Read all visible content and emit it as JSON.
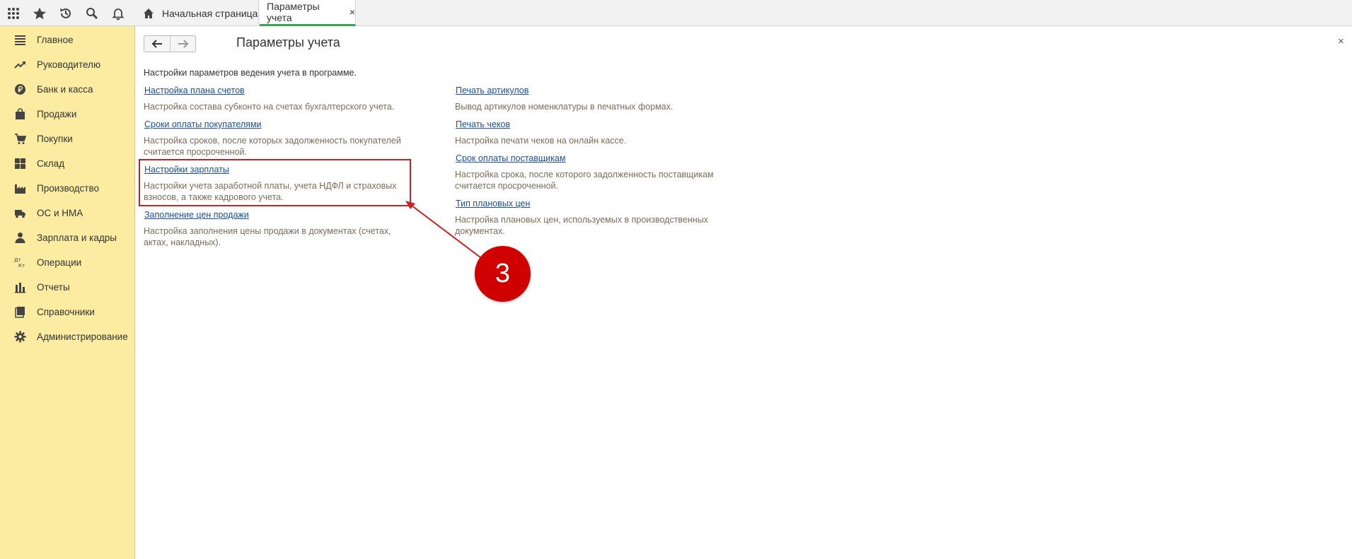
{
  "tabs": {
    "home": "Начальная страница",
    "params": "Параметры учета",
    "close": "×"
  },
  "sidebar": {
    "items": [
      {
        "label": "Главное",
        "icon": "menu-lines-icon"
      },
      {
        "label": "Руководителю",
        "icon": "trend-icon"
      },
      {
        "label": "Банк и касса",
        "icon": "ruble-coin-icon"
      },
      {
        "label": "Продажи",
        "icon": "shopping-bag-icon"
      },
      {
        "label": "Покупки",
        "icon": "cart-icon"
      },
      {
        "label": "Склад",
        "icon": "warehouse-grid-icon"
      },
      {
        "label": "Производство",
        "icon": "factory-icon"
      },
      {
        "label": "ОС и НМА",
        "icon": "truck-icon"
      },
      {
        "label": "Зарплата и кадры",
        "icon": "person-icon"
      },
      {
        "label": "Операции",
        "icon": "dt-kt-icon"
      },
      {
        "label": "Отчеты",
        "icon": "bar-chart-icon"
      },
      {
        "label": "Справочники",
        "icon": "books-icon"
      },
      {
        "label": "Администрирование",
        "icon": "gear-icon"
      }
    ]
  },
  "page": {
    "title": "Параметры учета",
    "close": "×",
    "intro": "Настройки параметров ведения учета в программе."
  },
  "settings": {
    "left": [
      {
        "link": "Настройка плана счетов",
        "desc": "Настройка состава субконто на счетах бухгалтерского учета."
      },
      {
        "link": "Сроки оплаты покупателями",
        "desc": "Настройка сроков, после которых задолженность покупателей считается просроченной."
      },
      {
        "link": "Настройки зарплаты",
        "desc": "Настройки учета заработной платы, учета НДФЛ и страховых взносов, а также кадрового учета."
      },
      {
        "link": "Заполнение цен продажи",
        "desc": "Настройка заполнения цены продажи в документах (счетах, актах, накладных)."
      }
    ],
    "right": [
      {
        "link": "Печать артикулов",
        "desc": "Вывод артикулов номенклатуры в печатных формах."
      },
      {
        "link": "Печать чеков",
        "desc": "Настройка печати чеков на онлайн кассе."
      },
      {
        "link": "Срок оплаты поставщикам",
        "desc": "Настройка срока, после которого задолженность поставщикам считается просроченной."
      },
      {
        "link": "Тип плановых цен",
        "desc": "Настройка плановых цен, используемых в производственных документах."
      }
    ]
  },
  "annotation": {
    "step": "3"
  },
  "colors": {
    "sidebar_bg": "#fbeca1",
    "link": "#1c4fa0",
    "desc": "#7a6d58",
    "annotation_red": "#d10000",
    "active_tab_underline": "#3aa655"
  }
}
